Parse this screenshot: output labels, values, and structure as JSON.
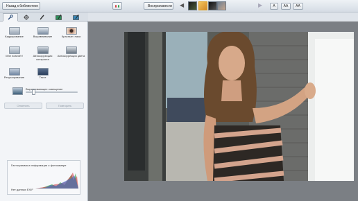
{
  "topbar": {
    "back_label": "Назад к библиотеке",
    "play_label": "Воспроизвести",
    "text_size_labels": [
      "A",
      "AA",
      "AA"
    ]
  },
  "tabs": [
    {
      "icon": "wrench-icon"
    },
    {
      "icon": "sliders-icon"
    },
    {
      "icon": "brush-icon"
    },
    {
      "icon": "frame-icon"
    },
    {
      "icon": "frame-pencil-icon"
    }
  ],
  "tools": {
    "row1": [
      "Кадрирование",
      "Выравнивание",
      "Красные глаза"
    ],
    "row2": [
      "Мне повезёт!",
      "Автокоррекция контраста",
      "Автокоррекция цвета"
    ],
    "row3": [
      "Ретуширование",
      "Текст"
    ],
    "fill_light": "Выравнивающее освещение"
  },
  "actions": {
    "undo": "Отменить",
    "redo": "Повторить"
  },
  "histogram": {
    "title": "Гистограмма и информация о фотокамере",
    "exif": "Нет данных EXIF"
  },
  "colors": {
    "accent": "#1f5fb8",
    "panel": "#f3f5f8",
    "stage": "#7b7f84"
  }
}
